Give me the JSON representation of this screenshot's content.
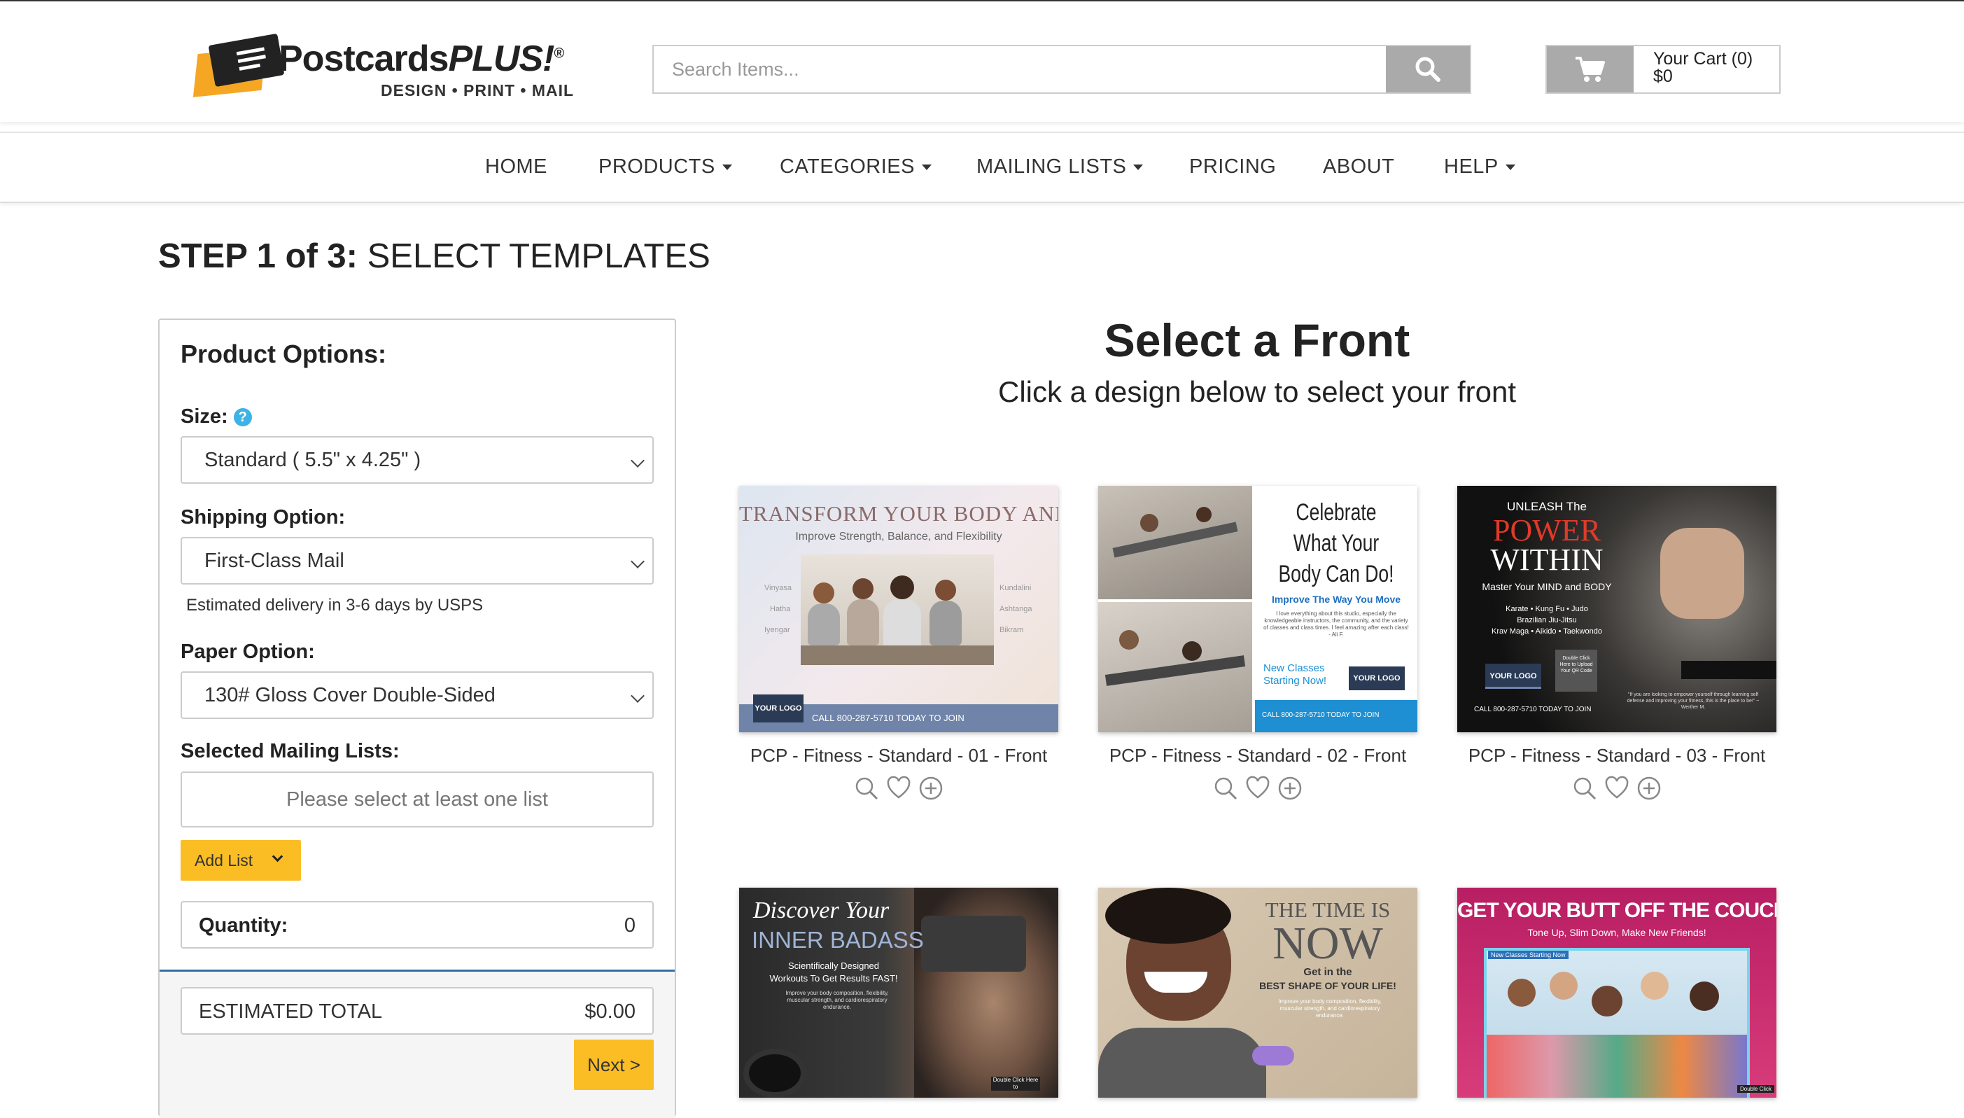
{
  "header": {
    "logo": {
      "name_main": "Postcards",
      "name_emph": "PLUS!",
      "reg": "®",
      "tagline": "DESIGN  •  PRINT  •  MAIL"
    },
    "search": {
      "placeholder": "Search Items..."
    },
    "cart": {
      "label": "Your Cart (0)",
      "amount": "$0"
    }
  },
  "nav": {
    "items": [
      {
        "label": "HOME",
        "dropdown": false
      },
      {
        "label": "PRODUCTS",
        "dropdown": true
      },
      {
        "label": "CATEGORIES",
        "dropdown": true
      },
      {
        "label": "MAILING LISTS",
        "dropdown": true
      },
      {
        "label": "PRICING",
        "dropdown": false
      },
      {
        "label": "ABOUT",
        "dropdown": false
      },
      {
        "label": "HELP",
        "dropdown": true
      }
    ]
  },
  "page": {
    "step_bold": "STEP 1 of 3:",
    "step_text": " SELECT TEMPLATES"
  },
  "options": {
    "heading": "Product Options:",
    "size": {
      "label": "Size:",
      "help_icon": "?",
      "value": "Standard ( 5.5\" x 4.25\" )"
    },
    "shipping": {
      "label": "Shipping Option:",
      "value": "First-Class Mail",
      "note": "Estimated delivery in 3-6 days by USPS"
    },
    "paper": {
      "label": "Paper Option:",
      "value": "130# Gloss Cover Double-Sided"
    },
    "mailing": {
      "label": "Selected Mailing Lists:",
      "placeholder": "Please select at least one list",
      "add_label": "Add List"
    },
    "quantity": {
      "label": "Quantity:",
      "value": "0"
    },
    "total": {
      "label": "ESTIMATED TOTAL",
      "value": "$0.00"
    },
    "next_label": "Next >"
  },
  "main": {
    "heading": "Select a Front",
    "subheading": "Click a design below to select your front",
    "templates": [
      {
        "caption": "PCP - Fitness - Standard - 01 - Front",
        "t1": "TRANSFORM YOUR BODY AND MIND",
        "t2": "Improve Strength, Balance, and Flexibility",
        "l1": "Vinyasa",
        "l2": "Hatha",
        "l3": "Iyengar",
        "r1": "Kundalini",
        "r2": "Ashtanga",
        "r3": "Bikram",
        "logo": "YOUR LOGO",
        "call": "CALL 800-287-5710 TODAY TO JOIN"
      },
      {
        "caption": "PCP - Fitness - Standard - 02 - Front",
        "t1": "Celebrate",
        "t2": "What Your",
        "t3": "Body Can Do!",
        "t4": "Improve The Way You Move",
        "t5": "I love everything about this studio, especially the knowledgeable instructors, the community, and the variety of classes and class times. I feel amazing after each class! - Ali F.",
        "t6": "New Classes",
        "t7": "Starting Now!",
        "logo": "YOUR LOGO",
        "call": "CALL 800-287-5710 TODAY TO JOIN"
      },
      {
        "caption": "PCP - Fitness - Standard - 03 - Front",
        "t1": "UNLEASH The",
        "t2": "POWER",
        "t3": "WITHIN",
        "t4": "Master Your MIND and BODY",
        "t5": "Karate  •  Kung Fu  •  Judo",
        "t6": "Brazilian Jiu-Jitsu",
        "t7": "Krav Maga  •  Aikido  •  Taekwondo",
        "logo": "YOUR LOGO",
        "qr": "Double Click Here to Upload Your QR Code",
        "call": "CALL 800-287-5710 TODAY TO JOIN",
        "quote": "\"If you are looking to empower yourself through learning self defense and improving your fitness, this is the place to be!\" ~ Werther M."
      },
      {
        "t1": "Discover Your",
        "t2": "INNER BADASS",
        "t3": "Scientifically Designed",
        "t4": "Workouts To Get Results FAST!",
        "t5": "Improve your body composition, flexibility, muscular strength, and cardiorespiratory endurance.",
        "t6": "Double Click Here to"
      },
      {
        "t1": "THE TIME IS",
        "t2": "NOW",
        "t3": "Get in the",
        "t4": "BEST SHAPE OF YOUR LIFE!",
        "t5": "Improve your body composition, flexibility, muscular strength, and cardiorespiratory endurance."
      },
      {
        "t1": "GET YOUR BUTT OFF THE COUCH",
        "t2": "Tone Up, Slim Down, Make New Friends!",
        "t3": "New Classes Starting Now",
        "t4": "Double Click"
      }
    ]
  },
  "colors": {
    "accent_yellow": "#fbbd24",
    "help_blue": "#3db2e6",
    "divider_blue": "#2f6fa8",
    "button_gray": "#aaaaaa"
  }
}
